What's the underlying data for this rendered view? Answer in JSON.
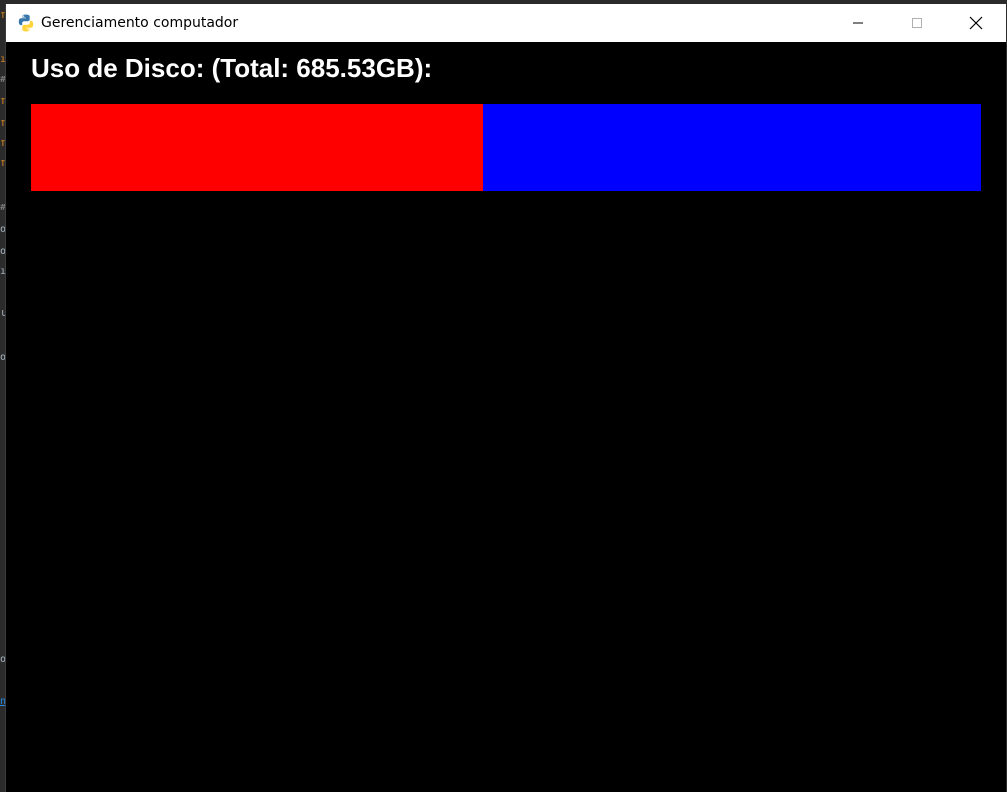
{
  "window": {
    "title": "Gerenciamento computador",
    "icon": "python-icon",
    "buttons": {
      "minimize": "minimize-icon",
      "maximize": "maximize-icon",
      "close": "close-icon"
    }
  },
  "disk": {
    "heading": "Uso de Disco: (Total: 685.53GB):",
    "used_fraction": 0.476,
    "used_color": "#ff0000",
    "free_color": "#0000ff"
  },
  "background_editor": {
    "glyphs": [
      "f",
      "i",
      "#",
      "f",
      "f",
      "f",
      "f",
      "#",
      "o",
      "o",
      "i",
      "l",
      "o",
      "o",
      "n"
    ],
    "colors": [
      "#e08a1e",
      "#a9b7c6",
      "#6a9955",
      "#1e88e5"
    ]
  }
}
